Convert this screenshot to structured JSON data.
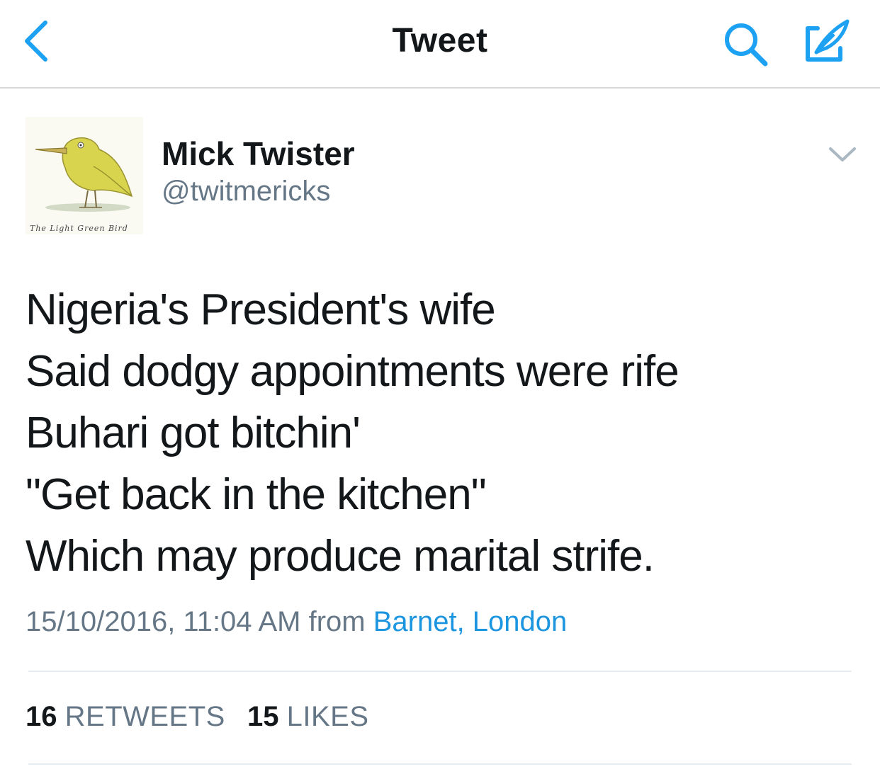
{
  "nav": {
    "title": "Tweet",
    "back_icon": "chevron-left-icon",
    "search_icon": "search-icon",
    "compose_icon": "compose-tweet-icon",
    "accent_color": "#1da1f2"
  },
  "tweet": {
    "author": {
      "display_name": "Mick Twister",
      "handle": "@twitmericks",
      "avatar_caption": "The Light Green Bird"
    },
    "lines": [
      "Nigeria's President's wife",
      "Said dodgy appointments were rife",
      "Buhari got bitchin'",
      "\"Get back in the kitchen\"",
      "Which may produce marital strife."
    ],
    "timestamp": "15/10/2016, 11:04 AM",
    "from_label": "from",
    "location": "Barnet, London",
    "retweets": {
      "count": "16",
      "label": "RETWEETS"
    },
    "likes": {
      "count": "15",
      "label": "LIKES"
    }
  },
  "colors": {
    "text": "#14171a",
    "secondary": "#657786",
    "link": "#1b95e0",
    "divider": "#e6ecf0"
  }
}
